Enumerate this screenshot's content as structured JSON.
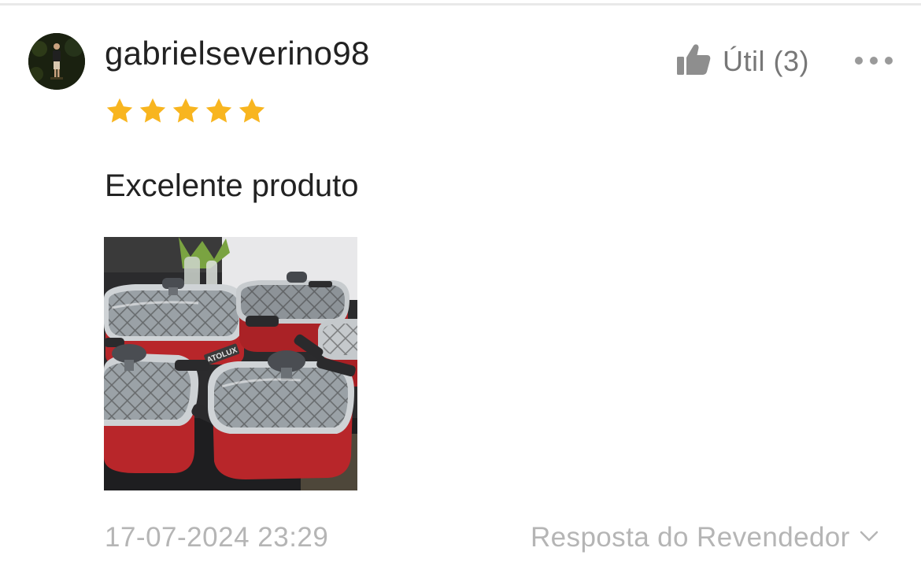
{
  "review": {
    "username": "gabrielseverino98",
    "rating": 5,
    "max_rating": 5,
    "text": "Excelente produto",
    "helpful_label": "Útil (3)",
    "date": "17-07-2024 23:29",
    "reply_label": "Resposta do Revendedor",
    "photo_brand_text": "ATOLUX"
  },
  "icons": {
    "avatar": "avatar",
    "star": "star-icon",
    "helpful": "thumbs-up-icon",
    "more": "more-options-icon",
    "reply": "chevron-down-icon"
  },
  "colors": {
    "star": "#f8b51f",
    "text_primary": "#222222",
    "text_secondary": "#777777",
    "text_muted": "#b5b5b5",
    "pot_red": "#b8262a"
  }
}
